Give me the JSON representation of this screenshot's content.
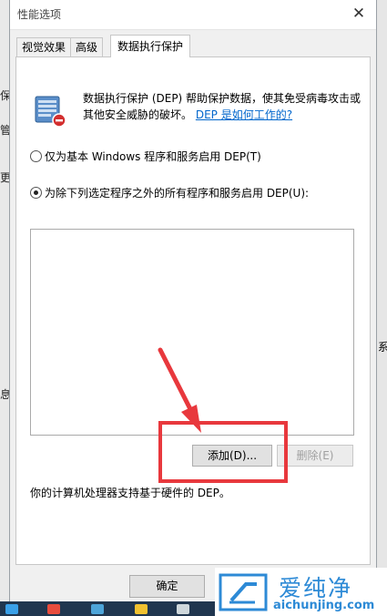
{
  "dialog": {
    "title": "性能选项",
    "close_glyph": "✕",
    "tabs": [
      {
        "label": "视觉效果"
      },
      {
        "label": "高级"
      },
      {
        "label": "数据执行保护",
        "active": true
      }
    ],
    "dep": {
      "description": "数据执行保护 (DEP) 帮助保护数据，使其免受病毒攻击或其他安全威胁的破坏。",
      "link": "DEP 是如何工作的?",
      "option1": "仅为基本 Windows 程序和服务启用 DEP(T)",
      "option2": "为除下列选定程序之外的所有程序和服务启用 DEP(U):",
      "selected_option": 2,
      "add_button": "添加(D)...",
      "remove_button": "删除(E)",
      "support_text": "你的计算机处理器支持基于硬件的 DEP。"
    },
    "ok_button": "确定"
  },
  "background_fragments": [
    "保",
    "管",
    "更",
    "息"
  ],
  "right_fragment": "系",
  "watermark": {
    "chinese": "爱纯净",
    "url": "aichunjing.com"
  },
  "colors": {
    "annotation_red": "#e8383d",
    "link_blue": "#0066cc",
    "watermark_blue": "#2d8ad6"
  }
}
